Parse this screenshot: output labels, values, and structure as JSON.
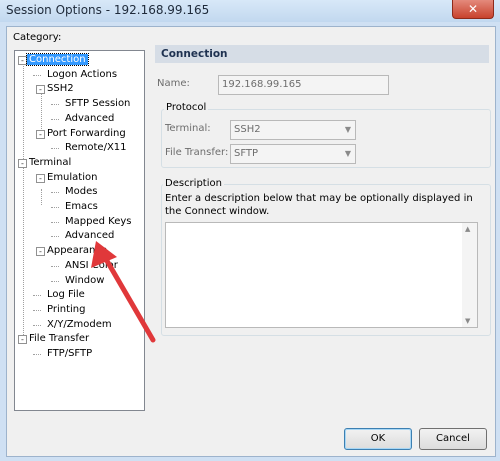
{
  "window": {
    "title": "Session Options - 192.168.99.165",
    "close_glyph": "✕"
  },
  "sidebar": {
    "category_label": "Category:",
    "tree": [
      {
        "label": "Connection",
        "level": 1,
        "expander": "-",
        "selected": true
      },
      {
        "label": "Logon Actions",
        "level": 2
      },
      {
        "label": "SSH2",
        "level": 2,
        "expander": "-"
      },
      {
        "label": "SFTP Session",
        "level": 3
      },
      {
        "label": "Advanced",
        "level": 3
      },
      {
        "label": "Port Forwarding",
        "level": 2,
        "expander": "-"
      },
      {
        "label": "Remote/X11",
        "level": 3
      },
      {
        "label": "Terminal",
        "level": 1,
        "expander": "-"
      },
      {
        "label": "Emulation",
        "level": 2,
        "expander": "-"
      },
      {
        "label": "Modes",
        "level": 3
      },
      {
        "label": "Emacs",
        "level": 3
      },
      {
        "label": "Mapped Keys",
        "level": 3
      },
      {
        "label": "Advanced",
        "level": 3
      },
      {
        "label": "Appearance",
        "level": 2,
        "expander": "-"
      },
      {
        "label": "ANSI Color",
        "level": 3
      },
      {
        "label": "Window",
        "level": 3
      },
      {
        "label": "Log File",
        "level": 2
      },
      {
        "label": "Printing",
        "level": 2
      },
      {
        "label": "X/Y/Zmodem",
        "level": 2
      },
      {
        "label": "File Transfer",
        "level": 1,
        "expander": "-"
      },
      {
        "label": "FTP/SFTP",
        "level": 2
      }
    ]
  },
  "main": {
    "header": "Connection",
    "name_label": "Name:",
    "name_value": "192.168.99.165",
    "protocol": {
      "title": "Protocol",
      "terminal_label": "Terminal:",
      "terminal_value": "SSH2",
      "file_transfer_label": "File Transfer:",
      "file_transfer_value": "SFTP"
    },
    "description": {
      "title": "Description",
      "hint": "Enter a description below that may be optionally displayed in the Connect window.",
      "value": ""
    }
  },
  "footer": {
    "ok_label": "OK",
    "cancel_label": "Cancel"
  },
  "colors": {
    "selection": "#3399ff",
    "annotation_arrow": "#e0383a",
    "header_bg": "#d6dde6"
  },
  "icons": {
    "scroll_up": "▲",
    "scroll_down": "▼",
    "combo_arrow": "▼"
  }
}
